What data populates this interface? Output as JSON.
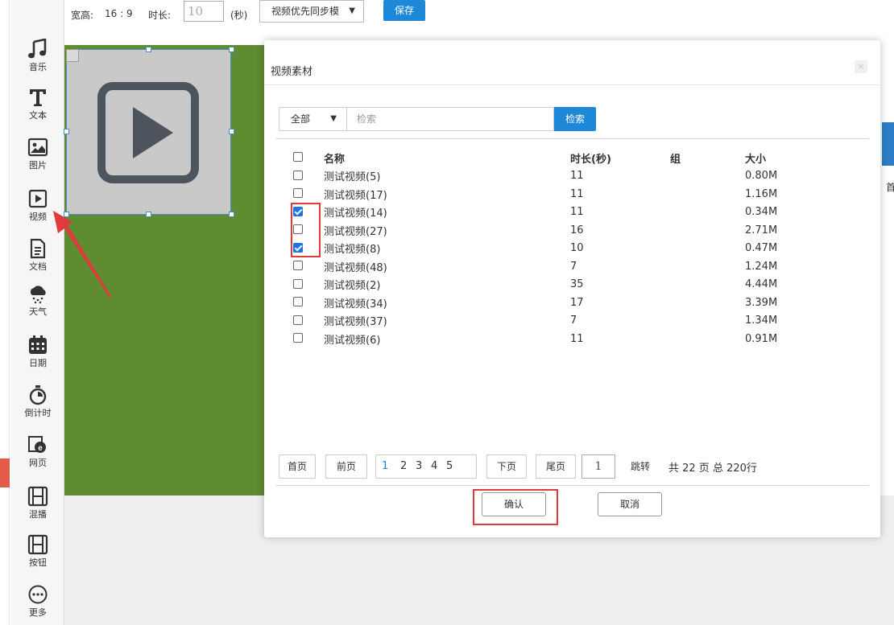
{
  "toolbar": {
    "items": [
      {
        "label": "音乐",
        "icon": "music-icon"
      },
      {
        "label": "文本",
        "icon": "text-icon"
      },
      {
        "label": "图片",
        "icon": "image-icon"
      },
      {
        "label": "视频",
        "icon": "video-icon"
      },
      {
        "label": "文档",
        "icon": "document-icon"
      },
      {
        "label": "天气",
        "icon": "weather-icon"
      },
      {
        "label": "日期",
        "icon": "calendar-icon"
      },
      {
        "label": "倒计时",
        "icon": "stopwatch-icon"
      },
      {
        "label": "网页",
        "icon": "webpage-icon"
      },
      {
        "label": "混播",
        "icon": "mixed-play-icon"
      },
      {
        "label": "按钮",
        "icon": "button-icon"
      },
      {
        "label": "更多",
        "icon": "more-icon"
      }
    ]
  },
  "topbar": {
    "aspect_label": "宽高:",
    "aspect_value": "16 : 9",
    "duration_label": "时长:",
    "duration_value": "10",
    "seconds_unit": "(秒)",
    "mode_value": "视频优先同步模",
    "save_label": "保存"
  },
  "right_edge_char": "首",
  "modal": {
    "title": "视频素材",
    "close_label": "×",
    "filter_value": "全部",
    "search_placeholder": "检索",
    "search_button": "检索",
    "columns": {
      "name": "名称",
      "duration": "时长(秒)",
      "group": "组",
      "size": "大小"
    },
    "rows": [
      {
        "name": "测试视频(5)",
        "duration": "11",
        "group": "",
        "size": "0.80M",
        "checked": false
      },
      {
        "name": "测试视频(17)",
        "duration": "11",
        "group": "",
        "size": "1.16M",
        "checked": false
      },
      {
        "name": "测试视频(14)",
        "duration": "11",
        "group": "",
        "size": "0.34M",
        "checked": true
      },
      {
        "name": "测试视频(27)",
        "duration": "16",
        "group": "",
        "size": "2.71M",
        "checked": false
      },
      {
        "name": "测试视频(8)",
        "duration": "10",
        "group": "",
        "size": "0.47M",
        "checked": true
      },
      {
        "name": "测试视频(48)",
        "duration": "7",
        "group": "",
        "size": "1.24M",
        "checked": false
      },
      {
        "name": "测试视频(2)",
        "duration": "35",
        "group": "",
        "size": "4.44M",
        "checked": false
      },
      {
        "name": "测试视频(34)",
        "duration": "17",
        "group": "",
        "size": "3.39M",
        "checked": false
      },
      {
        "name": "测试视频(37)",
        "duration": "7",
        "group": "",
        "size": "1.34M",
        "checked": false
      },
      {
        "name": "测试视频(6)",
        "duration": "11",
        "group": "",
        "size": "0.91M",
        "checked": false
      }
    ],
    "pagination": {
      "first": "首页",
      "prev": "前页",
      "pages": [
        "1",
        "2",
        "3",
        "4",
        "5"
      ],
      "current_page": "1",
      "next": "下页",
      "last": "尾页",
      "jump_value": "1",
      "jump": "跳转",
      "total": "共 22 页 总 220行"
    },
    "confirm_label": "确认",
    "cancel_label": "取消"
  },
  "colors": {
    "accent": "#1e88d8",
    "canvas_green": "#5f8b31",
    "annotation_red": "#e03a3a",
    "checkbox_blue": "#1a73e8"
  }
}
